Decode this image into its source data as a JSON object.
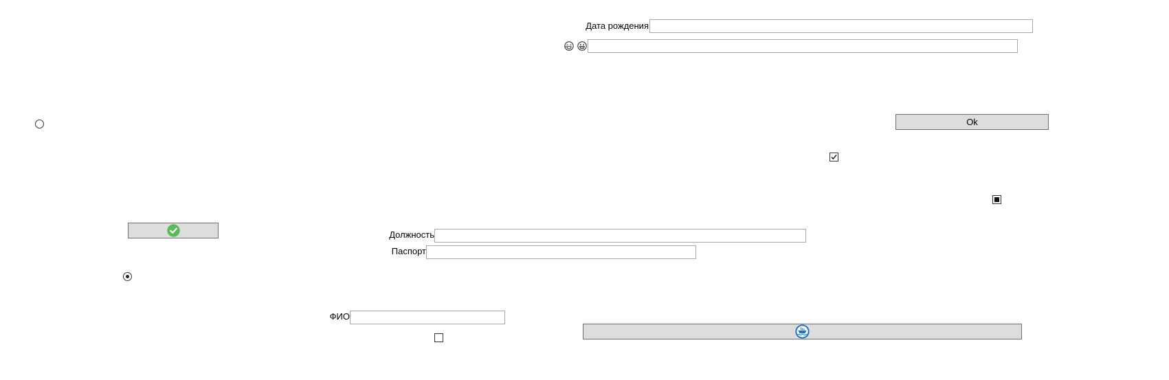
{
  "form": {
    "birthdate": {
      "label": "Дата рождения",
      "value": ""
    },
    "emoji_field": {
      "value": ""
    },
    "ok_button": {
      "label": "Ok"
    },
    "position": {
      "label": "Должность",
      "value": ""
    },
    "passport": {
      "label": "Паспорт",
      "value": ""
    },
    "fio": {
      "label": "ФИО",
      "value": ""
    },
    "radio_top": {
      "checked": false
    },
    "radio_bottom": {
      "checked": true
    },
    "checkbox_checked": {
      "checked": true
    },
    "checkbox_indeterminate": {
      "state": "indeterminate"
    },
    "checkbox_bottom": {
      "checked": false
    },
    "confirm_button": {
      "icon": "green-checkmark-icon",
      "color": "#5cb85c"
    },
    "ship_button": {
      "icon": "ship-icon",
      "color": "#1a73c9"
    },
    "emoji_icons": [
      "laughing-face-icon",
      "grinning-face-icon"
    ]
  }
}
